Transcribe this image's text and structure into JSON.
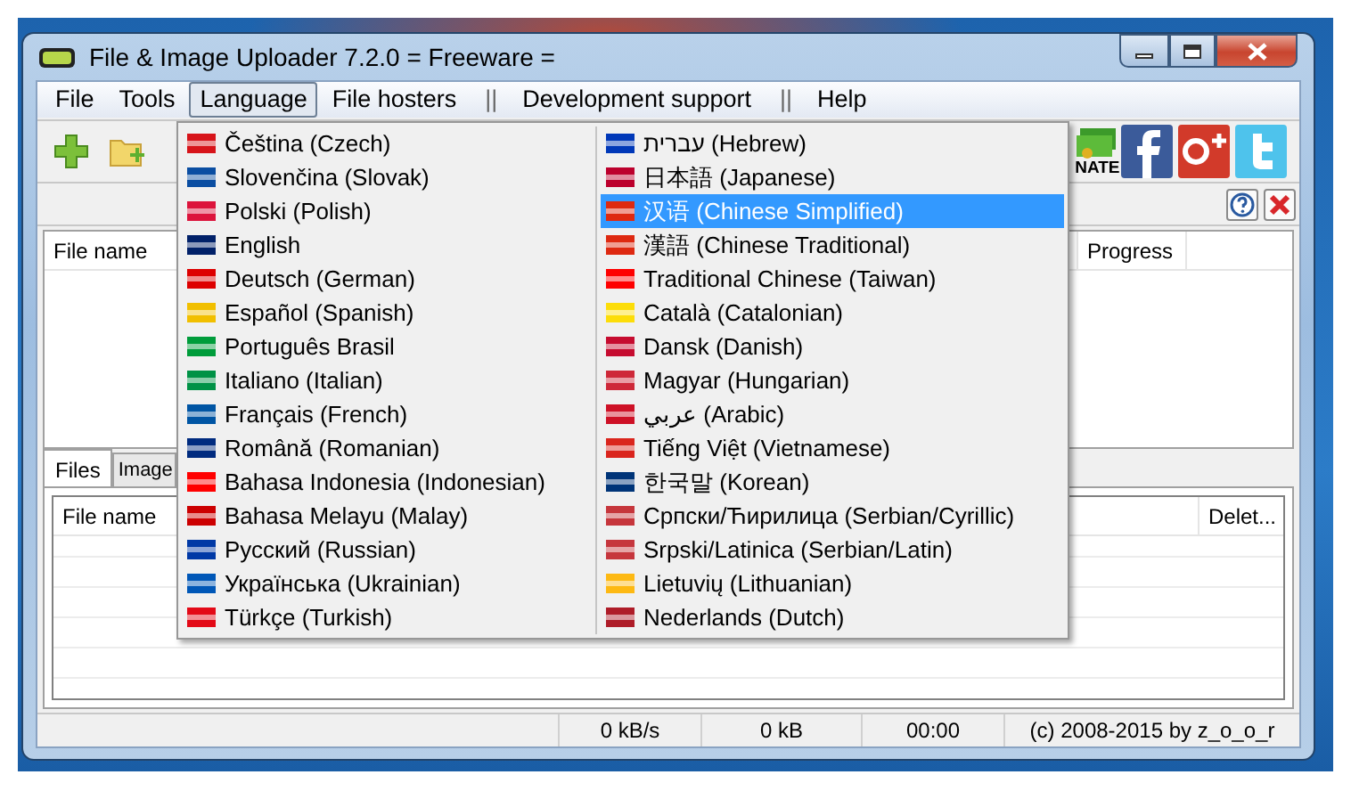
{
  "window": {
    "title": "File & Image Uploader 7.2.0  = Freeware ="
  },
  "menu_bar": [
    {
      "kind": "item",
      "label": "File",
      "selected": false
    },
    {
      "kind": "item",
      "label": "Tools",
      "selected": false
    },
    {
      "kind": "item",
      "label": "Language",
      "selected": true
    },
    {
      "kind": "item",
      "label": "File hosters",
      "selected": false
    },
    {
      "kind": "separator",
      "label": "||"
    },
    {
      "kind": "item",
      "label": "Development support",
      "selected": false
    },
    {
      "kind": "separator",
      "label": "||"
    },
    {
      "kind": "item",
      "label": "Help",
      "selected": false
    }
  ],
  "toolbar": {
    "donate_label": "NATE"
  },
  "upper_list": {
    "columns": [
      "File name",
      "Progress"
    ]
  },
  "tabs": [
    {
      "label": "Files",
      "selected": true
    },
    {
      "label": "Image",
      "selected": false
    }
  ],
  "lower_list": {
    "columns": [
      "File name",
      "Delet..."
    ]
  },
  "status_bar": [
    "0 kB/s",
    "0 kB",
    "00:00",
    "(c) 2008-2015 by z_o_o_r"
  ],
  "language_menu": {
    "columns": [
      [
        {
          "label": "Čeština (Czech)",
          "color": "#d7141a",
          "selected": false
        },
        {
          "label": "Slovenčina (Slovak)",
          "color": "#0b4ea2",
          "selected": false
        },
        {
          "label": "Polski (Polish)",
          "color": "#dc143c",
          "selected": false
        },
        {
          "label": "English",
          "color": "#012169",
          "selected": false
        },
        {
          "label": "Deutsch (German)",
          "color": "#dd0000",
          "selected": false
        },
        {
          "label": "Español (Spanish)",
          "color": "#f1bf00",
          "selected": false
        },
        {
          "label": "Português Brasil",
          "color": "#009c3b",
          "selected": false
        },
        {
          "label": "Italiano (Italian)",
          "color": "#009246",
          "selected": false
        },
        {
          "label": "Français (French)",
          "color": "#0055a4",
          "selected": false
        },
        {
          "label": "Română (Romanian)",
          "color": "#002b7f",
          "selected": false
        },
        {
          "label": "Bahasa Indonesia (Indonesian)",
          "color": "#ff0000",
          "selected": false
        },
        {
          "label": "Bahasa Melayu (Malay)",
          "color": "#cc0001",
          "selected": false
        },
        {
          "label": "Русский (Russian)",
          "color": "#0039a6",
          "selected": false
        },
        {
          "label": "Українська (Ukrainian)",
          "color": "#0057b7",
          "selected": false
        },
        {
          "label": "Türkçe (Turkish)",
          "color": "#e30a17",
          "selected": false
        }
      ],
      [
        {
          "label": "עברית (Hebrew)",
          "color": "#0038b8",
          "selected": false
        },
        {
          "label": "日本語 (Japanese)",
          "color": "#bc002d",
          "selected": false
        },
        {
          "label": "汉语 (Chinese Simplified)",
          "color": "#de2910",
          "selected": true
        },
        {
          "label": "漢語 (Chinese Traditional)",
          "color": "#de2911",
          "selected": false
        },
        {
          "label": "Traditional Chinese (Taiwan)",
          "color": "#fe0000",
          "selected": false
        },
        {
          "label": "Català (Catalonian)",
          "color": "#fcdd09",
          "selected": false
        },
        {
          "label": "Dansk (Danish)",
          "color": "#c60c30",
          "selected": false
        },
        {
          "label": "Magyar (Hungarian)",
          "color": "#ce2939",
          "selected": false
        },
        {
          "label": "عربي (Arabic)",
          "color": "#ce1126",
          "selected": false
        },
        {
          "label": "Tiếng Việt (Vietnamese)",
          "color": "#da251d",
          "selected": false
        },
        {
          "label": "한국말 (Korean)",
          "color": "#003478",
          "selected": false
        },
        {
          "label": "Српски/Ћирилица (Serbian/Cyrillic)",
          "color": "#c6363c",
          "selected": false
        },
        {
          "label": "Srpski/Latinica (Serbian/Latin)",
          "color": "#c6363d",
          "selected": false
        },
        {
          "label": "Lietuvių (Lithuanian)",
          "color": "#fdb913",
          "selected": false
        },
        {
          "label": "Nederlands (Dutch)",
          "color": "#ae1c28",
          "selected": false
        }
      ]
    ]
  }
}
